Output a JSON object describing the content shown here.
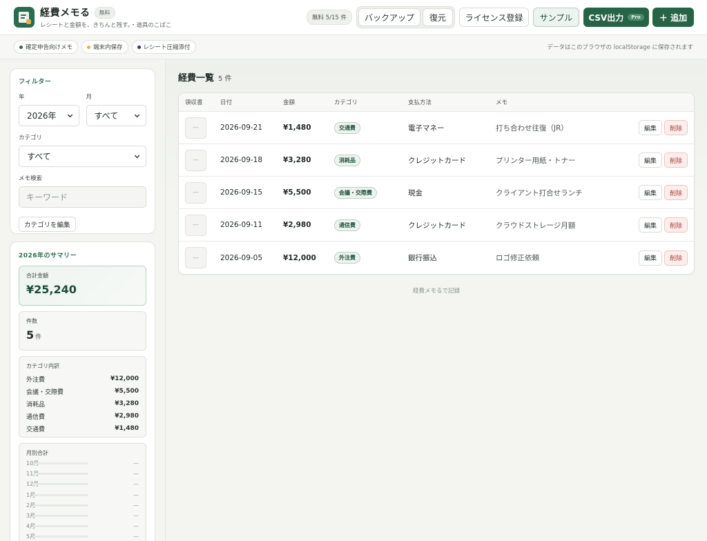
{
  "header": {
    "title": "経費メモる",
    "free_badge": "無料",
    "subtitle": "レシートと金額を、きちんと残す。・道具のこばこ",
    "count_pill": "無料 5/15 件",
    "backup_label": "バックアップ",
    "restore_label": "復元",
    "license_label": "ライセンス登録",
    "sample_label": "サンプル",
    "csv_label": "CSV出力",
    "pro_badge": "Pro",
    "add_label": "＋ 追加"
  },
  "subbar": {
    "tags": [
      {
        "label": "確定申告向けメモ",
        "dot_color": "#2a6a4e"
      },
      {
        "label": "端末内保存",
        "dot_color": "#e2b24a"
      },
      {
        "label": "レシート圧縮添付",
        "dot_color": "#2c3a66"
      }
    ],
    "storage_note": "データはこのブラウザの localStorage に保存されます"
  },
  "filter": {
    "title": "フィルター",
    "year_label": "年",
    "year_value": "2026年",
    "month_label": "月",
    "month_value": "すべて",
    "category_label": "カテゴリ",
    "category_value": "すべて",
    "search_label": "メモ検索",
    "search_placeholder": "キーワード",
    "edit_categories_label": "カテゴリを編集"
  },
  "summary": {
    "title": "2026年のサマリー",
    "total_label": "合計金額",
    "total_value": "¥25,240",
    "count_label": "件数",
    "count_value": "5",
    "count_unit": "件",
    "category_breakdown_label": "カテゴリ内訳",
    "categories": [
      {
        "name": "外注費",
        "amount": "¥12,000"
      },
      {
        "name": "会議・交際費",
        "amount": "¥5,500"
      },
      {
        "name": "消耗品",
        "amount": "¥3,280"
      },
      {
        "name": "通信費",
        "amount": "¥2,980"
      },
      {
        "name": "交通費",
        "amount": "¥1,480"
      }
    ],
    "monthly_label": "月別合計",
    "months": [
      {
        "month": "10月",
        "value": "—"
      },
      {
        "month": "11月",
        "value": "—"
      },
      {
        "month": "12月",
        "value": "—"
      },
      {
        "month": "1月",
        "value": "—"
      },
      {
        "month": "2月",
        "value": "—"
      },
      {
        "month": "3月",
        "value": "—"
      },
      {
        "month": "4月",
        "value": "—"
      },
      {
        "month": "5月",
        "value": "—"
      }
    ]
  },
  "list": {
    "title": "経費一覧",
    "count": "5 件",
    "columns": [
      "領収書",
      "日付",
      "金額",
      "カテゴリ",
      "支払方法",
      "メモ"
    ],
    "receipt_placeholder": "—",
    "edit_label": "編集",
    "delete_label": "削除",
    "rows": [
      {
        "date": "2026-09-21",
        "amount": "¥1,480",
        "category": "交通費",
        "payment": "電子マネー",
        "memo": "打ち合わせ往復（JR）"
      },
      {
        "date": "2026-09-18",
        "amount": "¥3,280",
        "category": "消耗品",
        "payment": "クレジットカード",
        "memo": "プリンター用紙・トナー"
      },
      {
        "date": "2026-09-15",
        "amount": "¥5,500",
        "category": "会議・交際費",
        "payment": "現金",
        "memo": "クライアント打合せランチ"
      },
      {
        "date": "2026-09-11",
        "amount": "¥2,980",
        "category": "通信費",
        "payment": "クレジットカード",
        "memo": "クラウドストレージ月額"
      },
      {
        "date": "2026-09-05",
        "amount": "¥12,000",
        "category": "外注費",
        "payment": "銀行振込",
        "memo": "ロゴ修正依頼"
      }
    ],
    "footer_note": "経費メモるで記録"
  }
}
